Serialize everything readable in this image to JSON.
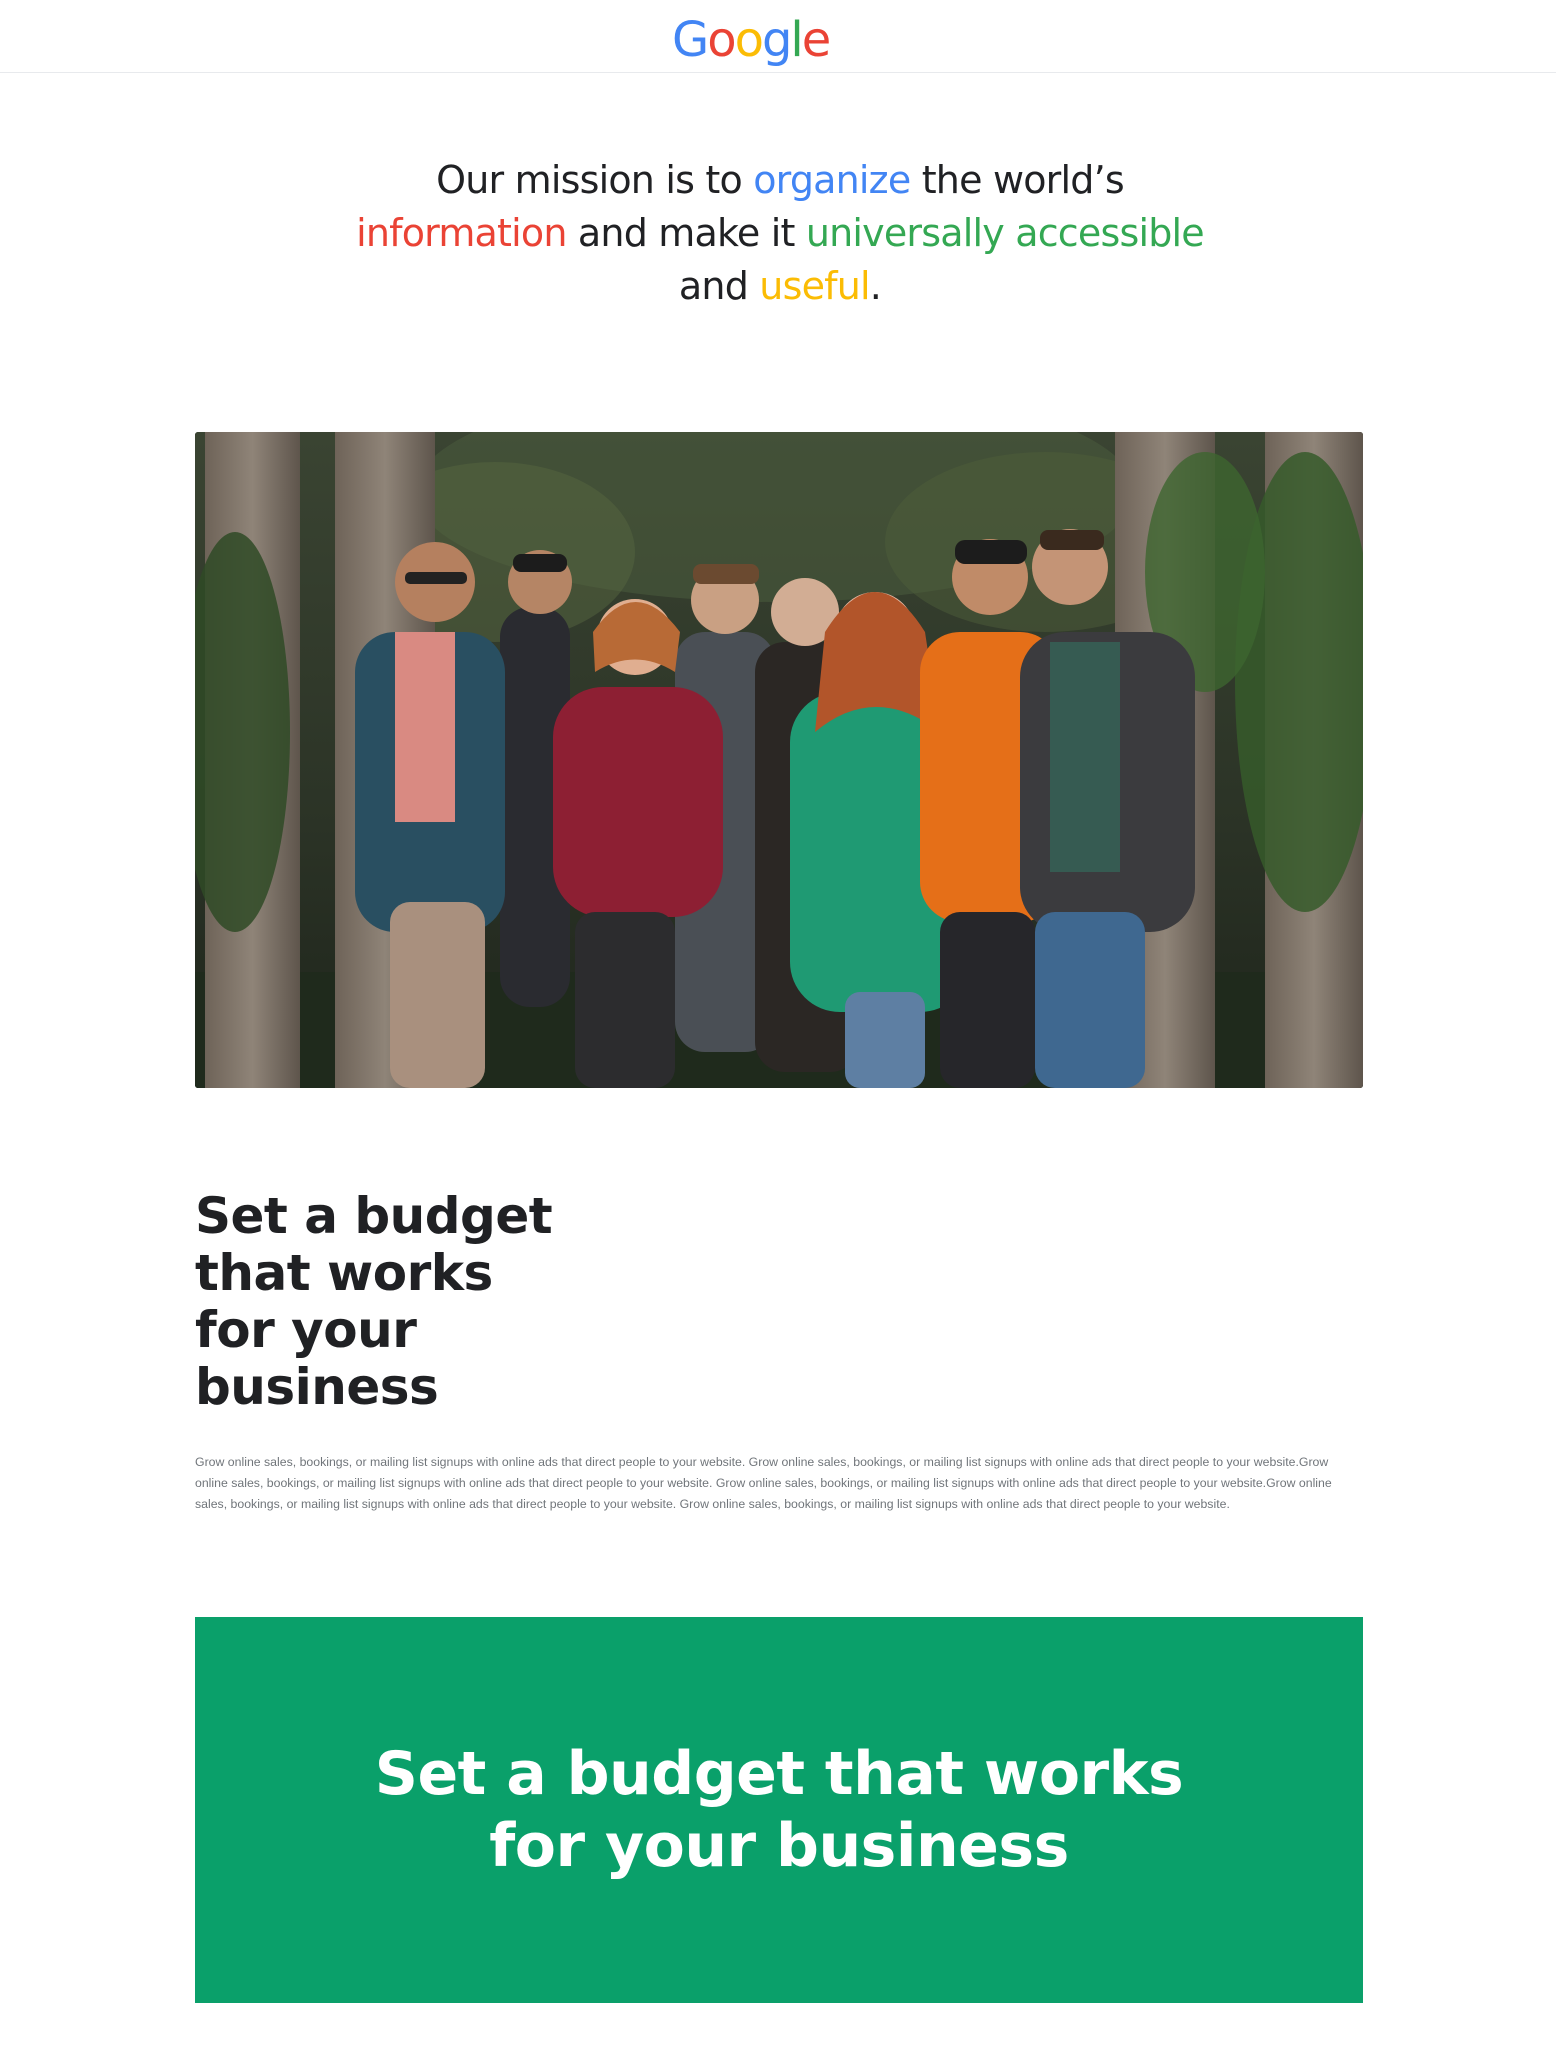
{
  "header": {
    "logo_letters": [
      "G",
      "o",
      "o",
      "g",
      "l",
      "e"
    ],
    "logo_colors": [
      "#4285F4",
      "#EA4335",
      "#FBBC05",
      "#4285F4",
      "#34A853",
      "#EA4335"
    ]
  },
  "mission": {
    "part1": "Our mission is to ",
    "organize": "organize",
    "part2": " the world’s ",
    "information": "information",
    "part3": " and make it ",
    "universally_accessible": "universally accessible",
    "part4": " and ",
    "useful": "useful",
    "part5": "."
  },
  "colors": {
    "blue": "#4285F4",
    "red": "#EA4335",
    "green": "#34A853",
    "yellow": "#FBBC04",
    "banner": "#0AA06A"
  },
  "section": {
    "title": "Set a budget that works for your business",
    "body": "Grow online sales, bookings, or mailing list signups with online ads that direct people to your website. Grow online sales, bookings, or mailing list signups with online ads that direct people to your website.Grow online sales, bookings, or mailing list signups with online ads that direct people to your website. Grow online sales, bookings, or mailing list signups with online ads that direct people to your website.Grow online sales, bookings, or mailing list signups with online ads that direct people to your website. Grow online sales, bookings, or mailing list signups with online ads that direct people to your website."
  },
  "banner": {
    "title": "Set a budget that works for your business"
  }
}
